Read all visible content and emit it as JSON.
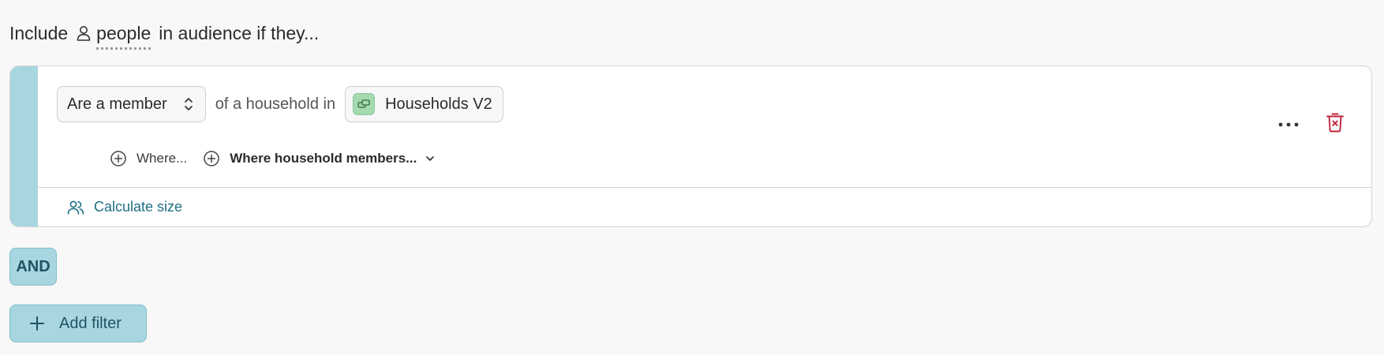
{
  "heading": {
    "prefix": "Include",
    "entity": "people",
    "suffix": "in audience if they..."
  },
  "condition": {
    "membership_select": "Are a member",
    "connector": "of a household in",
    "source": "Households V2",
    "add_where": "Where...",
    "add_where_members": "Where household members..."
  },
  "footer": {
    "calculate_size": "Calculate size"
  },
  "logic": {
    "operator": "AND"
  },
  "actions": {
    "add_filter": "Add filter"
  },
  "colors": {
    "accent_stripe": "#a8d6e0",
    "link": "#1d6f84",
    "delete": "#c0233a",
    "source_icon_bg": "#a4dab0"
  },
  "icons": {
    "person": "person-icon",
    "select_chevron": "up-down-chevron-icon",
    "source": "table-icon",
    "add": "plus-circle-icon",
    "dropdown": "chevron-down-icon",
    "calculate": "people-icon",
    "more": "more-horizontal-icon",
    "delete": "trash-icon",
    "add_filter": "plus-icon"
  }
}
